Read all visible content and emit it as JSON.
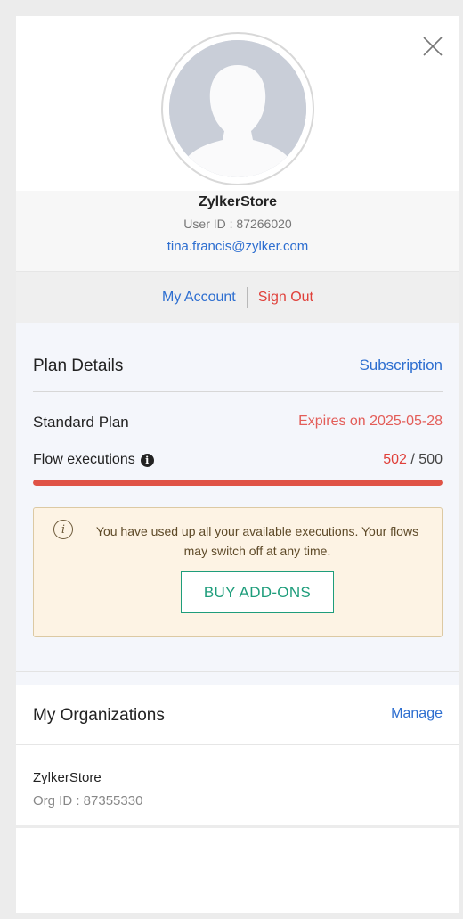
{
  "profile": {
    "name": "ZylkerStore",
    "user_id": "User ID : 87266020",
    "email": "tina.francis@zylker.com"
  },
  "account_bar": {
    "my_account": "My Account",
    "sign_out": "Sign Out"
  },
  "plan": {
    "title": "Plan Details",
    "subscription_link": "Subscription",
    "name": "Standard Plan",
    "expiry": "Expires on 2025-05-28",
    "flow_label": "Flow executions",
    "flow_used": "502",
    "flow_separator": " / ",
    "flow_limit": "500",
    "usage_fraction": 1.0
  },
  "alert": {
    "message": "You have used up all your available executions. Your flows may switch off at any time.",
    "button_label": "BUY ADD-ONS"
  },
  "organizations": {
    "title": "My Organizations",
    "manage_link": "Manage",
    "items": [
      {
        "name": "ZylkerStore",
        "org_id": "Org ID : 87355330"
      }
    ]
  },
  "colors": {
    "link": "#2d6ed0",
    "danger": "#e0403a",
    "accent": "#1e9d7b",
    "alert_bg": "#fdf3e4"
  },
  "icons": {
    "close": "close-icon",
    "avatar": "avatar-placeholder",
    "info": "info-icon",
    "alert": "info-circle-icon"
  }
}
